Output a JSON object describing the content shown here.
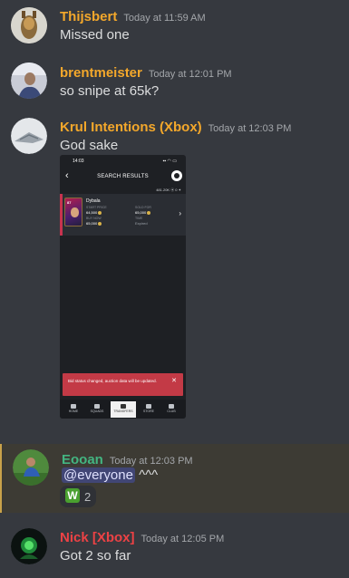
{
  "messages": [
    {
      "username": "Thijsbert",
      "timestamp": "Today at 11:59 AM",
      "text": "Missed one",
      "color": "#f4a82b"
    },
    {
      "username": "brentmeister",
      "timestamp": "Today at 12:01 PM",
      "text": "so snipe at 65k?",
      "color": "#f4a82b"
    },
    {
      "username": "Krul Intentions (Xbox)",
      "timestamp": "Today at 12:03 PM",
      "text": "God sake",
      "color": "#f4a82b"
    },
    {
      "username": "Eooan",
      "timestamp": "Today at 12:03 PM",
      "mention": "@everyone",
      "text": "^^^",
      "color": "#43b581",
      "reaction": {
        "emoji": "W",
        "count": "2"
      }
    },
    {
      "username": "Nick [Xbox]",
      "timestamp": "Today at 12:05 PM",
      "text": "Got 2 so far",
      "color": "#ed4245"
    }
  ],
  "attachment": {
    "status_time": "14:03",
    "status_icons": "▪▪ ◠ ▭",
    "back": "‹",
    "title": "SEARCH RESULTS",
    "coins": "481.20K ⦿ 0 ✦",
    "player": {
      "rating": "87",
      "name": "Dybala",
      "start_price_label": "START PRICE",
      "start_price": "64,500",
      "buy_now_label": "BUY NOW",
      "buy_now": "65,000",
      "sold_for_label": "SOLD FOR",
      "sold_for": "65,000",
      "time_label": "TIME",
      "time": "Expired"
    },
    "chevron": "›",
    "toast": "Bid status changed, auction data will be updated.",
    "toast_close": "✕",
    "tabs": [
      "HOME",
      "SQUADS",
      "TRANSFERS",
      "STORE",
      "CLUB"
    ],
    "active_tab": "TRANSFERS"
  }
}
